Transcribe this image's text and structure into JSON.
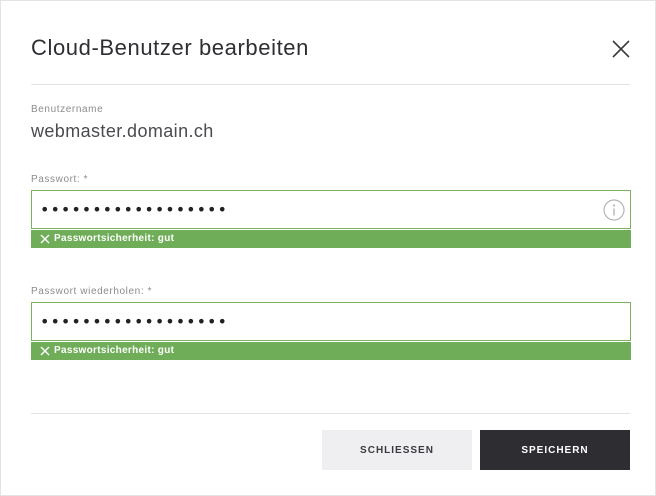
{
  "dialog": {
    "title": "Cloud-Benutzer bearbeiten",
    "close_icon": "close-icon"
  },
  "username": {
    "label": "Benutzername",
    "value": "webmaster.domain.ch"
  },
  "password": {
    "label": "Passwort: *",
    "value": "••••••••••••••••••",
    "info_icon": "info-icon",
    "strength_icon": "x-icon",
    "strength_text": "Passwortsicherheit: gut"
  },
  "password_repeat": {
    "label": "Passwort wiederholen: *",
    "value": "••••••••••••••••••",
    "strength_icon": "x-icon",
    "strength_text": "Passwortsicherheit: gut"
  },
  "buttons": {
    "close_label": "SCHLIESSEN",
    "save_label": "SPEICHERN"
  },
  "colors": {
    "strength_ok": "#6fad58",
    "field_border_ok": "#7ab25f",
    "primary_button": "#2e2e32",
    "secondary_button": "#efeff2"
  }
}
